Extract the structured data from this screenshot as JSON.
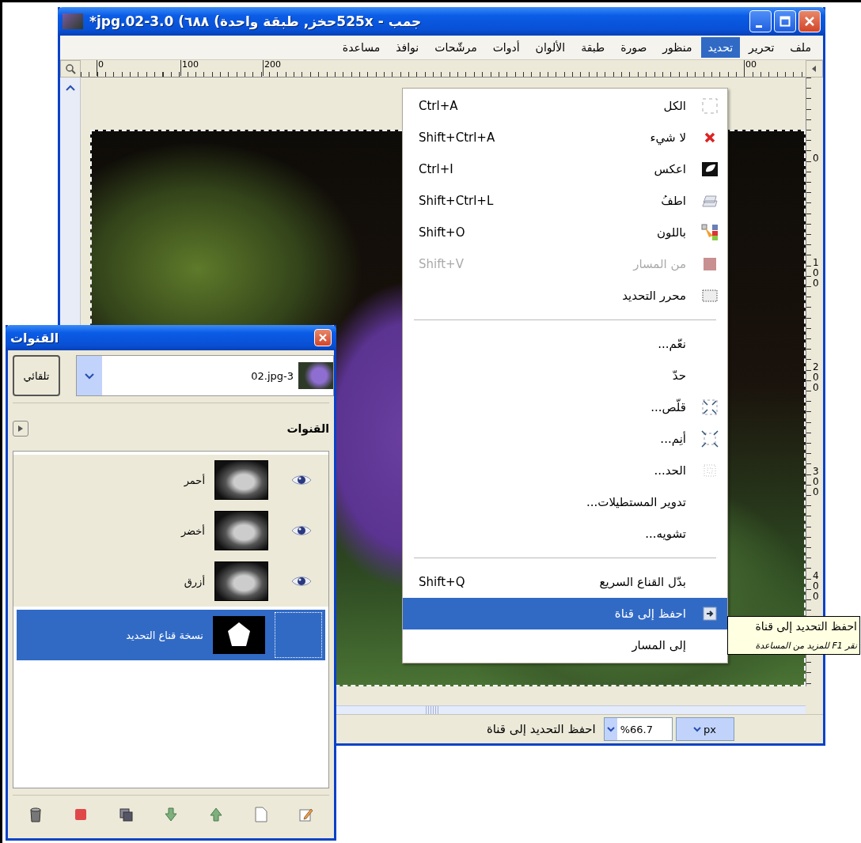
{
  "window": {
    "title": "جمب - 525xحخز, طبقة واحدة) ٦٨٨) 3.0-02.jpg*",
    "menu_bar": [
      {
        "label": "ملف",
        "selected": false
      },
      {
        "label": "تحرير",
        "selected": false
      },
      {
        "label": "تحديد",
        "selected": true
      },
      {
        "label": "منظور",
        "selected": false
      },
      {
        "label": "صورة",
        "selected": false
      },
      {
        "label": "طبقة",
        "selected": false
      },
      {
        "label": "الألوان",
        "selected": false
      },
      {
        "label": "أدوات",
        "selected": false
      },
      {
        "label": "مرشّحات",
        "selected": false
      },
      {
        "label": "نوافذ",
        "selected": false
      },
      {
        "label": "مساعدة",
        "selected": false
      }
    ]
  },
  "rulers": {
    "horizontal": [
      "00",
      "200",
      "100",
      "0"
    ],
    "vertical": [
      "0",
      "100",
      "200",
      "300",
      "400"
    ]
  },
  "menu": {
    "items": [
      {
        "kind": "item",
        "label": "الكل",
        "shortcut": "Ctrl+A",
        "disabled": false,
        "selected": false
      },
      {
        "kind": "item",
        "label": "لا شيء",
        "shortcut": "Shift+Ctrl+A",
        "disabled": false,
        "selected": false
      },
      {
        "kind": "item",
        "label": "اعكس",
        "shortcut": "Ctrl+I",
        "disabled": false,
        "selected": false
      },
      {
        "kind": "item",
        "label": "اطفُ",
        "shortcut": "Shift+Ctrl+L",
        "disabled": false,
        "selected": false
      },
      {
        "kind": "item",
        "label": "باللون",
        "shortcut": "Shift+O",
        "disabled": false,
        "selected": false
      },
      {
        "kind": "item",
        "label": "من المسار",
        "shortcut": "Shift+V",
        "disabled": true,
        "selected": false
      },
      {
        "kind": "item",
        "label": "محرر التحديد",
        "disabled": false,
        "selected": false
      },
      {
        "kind": "separator"
      },
      {
        "kind": "item",
        "label": "نعّم...",
        "disabled": false,
        "selected": false
      },
      {
        "kind": "item",
        "label": "حدّ",
        "disabled": false,
        "selected": false
      },
      {
        "kind": "item",
        "label": "قلّص...",
        "disabled": false,
        "selected": false
      },
      {
        "kind": "item",
        "label": "أنِم...",
        "disabled": false,
        "selected": false
      },
      {
        "kind": "item",
        "label": "الحد...",
        "disabled": false,
        "selected": false
      },
      {
        "kind": "item",
        "label": "تدوير المستطيلات...",
        "disabled": false,
        "selected": false
      },
      {
        "kind": "item",
        "label": "تشويه...",
        "disabled": false,
        "selected": false
      },
      {
        "kind": "separator"
      },
      {
        "kind": "item",
        "label": "بدّل القناع السريع",
        "shortcut": "Shift+Q",
        "disabled": false,
        "selected": false
      },
      {
        "kind": "item",
        "label": "احفظ إلى قناة",
        "disabled": false,
        "selected": true
      },
      {
        "kind": "item",
        "label": "إلى المسار",
        "disabled": false,
        "selected": false
      }
    ]
  },
  "tooltip": {
    "title": "احفظ التحديد إلى قناة",
    "hint": "نقر F1 للمزيد من المساعدة"
  },
  "status_bar": {
    "message": "احفظ التحديد إلى قناة",
    "zoom": "%66.7",
    "unit": "px"
  },
  "channels_dialog": {
    "title": "القنوات",
    "image": "02.jpg-3",
    "auto_button": "تلقائي",
    "section": "القنوات",
    "channels": [
      {
        "name": "أحمر",
        "kind": "color",
        "visible": true,
        "selected": false
      },
      {
        "name": "أخضر",
        "kind": "color",
        "visible": true,
        "selected": false
      },
      {
        "name": "أزرق",
        "kind": "color",
        "visible": true,
        "selected": false
      },
      {
        "name": "نسخة قناع التحديد",
        "kind": "mask",
        "visible": false,
        "selected": true
      }
    ]
  }
}
